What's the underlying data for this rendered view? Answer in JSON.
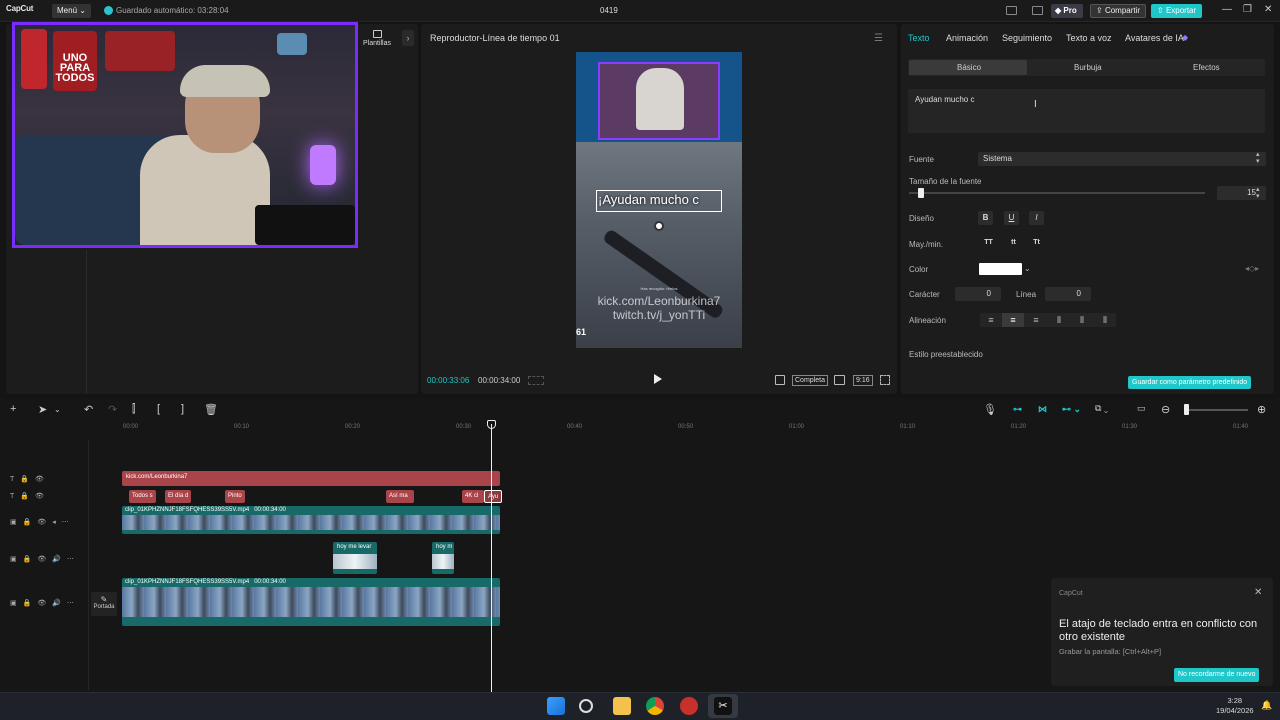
{
  "titlebar": {
    "app_name": "CapCut",
    "menu_label": "Menú",
    "autosave_text": "Guardado automático: 03:28:04",
    "project_title": "0419",
    "pro_label": "Pro",
    "share_label": "Compartir",
    "export_label": "Exportar"
  },
  "media": {
    "templates_label": "Plantillas",
    "webcam_sign": "UNO PARA TODOS"
  },
  "player": {
    "title": "Reproductor-Línea de tiempo 01",
    "caption": "¡Ayudan mucho c",
    "watermark1": "kick.com/Leonburkina7",
    "watermark2": "twitch.tv/j_yonTTi",
    "small_text": "Has recogido: Hielos",
    "corner": "61",
    "current_time": "00:00:33:06",
    "total_time": "00:00:34:00",
    "full_label": "Completa",
    "ratio_label": "9:16"
  },
  "props": {
    "tabs": [
      "Texto",
      "Animación",
      "Seguimiento",
      "Texto a voz",
      "Avatares de IA"
    ],
    "subtabs": [
      "Básico",
      "Burbuja",
      "Efectos"
    ],
    "text_value": "Ayudan mucho c",
    "font_label": "Fuente",
    "font_value": "Sistema",
    "size_label": "Tamaño de la fuente",
    "size_value": "15",
    "design_label": "Diseño",
    "case_label": "May./min.",
    "case_options": [
      "TT",
      "tt",
      "Tt"
    ],
    "color_label": "Color",
    "spacing_label": "Carácter",
    "spacing_value": "0",
    "line_label": "Línea",
    "line_value": "0",
    "align_label": "Alineación",
    "preset_label": "Estilo preestablecido",
    "save_preset_label": "Guardar como parámetro predefinido"
  },
  "timeline": {
    "ruler": [
      "00:00",
      "00:10",
      "00:20",
      "00:30",
      "00:40",
      "00:50",
      "01:00",
      "01:10",
      "01:20",
      "01:30",
      "01:40"
    ],
    "text_track_label": "kick.com/Leonburkina7",
    "chips": [
      "Todos s",
      "El día d",
      "Pinto",
      "Así ma",
      "4K cl",
      "Ayu"
    ],
    "video1_label": "clip_01KPHZNNJF18FSFQHESS39SS5V.mp4",
    "video1_duration": "00:00:34:00",
    "audio_clip1": "hoy me levar",
    "audio_clip2": "hoy m",
    "video2_label": "clip_01KPHZNNJF18FSFQHESS39SS5V.mp4",
    "video2_duration": "00:00:34:00",
    "cover_label": "Portada"
  },
  "notification": {
    "brand": "CapCut",
    "title": "El atajo de teclado entra en conflicto con otro existente",
    "subtitle": "Grabar la pantalla: [Ctrl+Alt+P]",
    "button": "No recordarme de nuevo"
  },
  "taskbar": {
    "time": "3:28",
    "date": "19/04/2026"
  },
  "colors": {
    "accent": "#1fc7c9",
    "text_clip": "#a9454a",
    "video_clip": "#176a67",
    "webcam_border": "#7a2bff"
  }
}
